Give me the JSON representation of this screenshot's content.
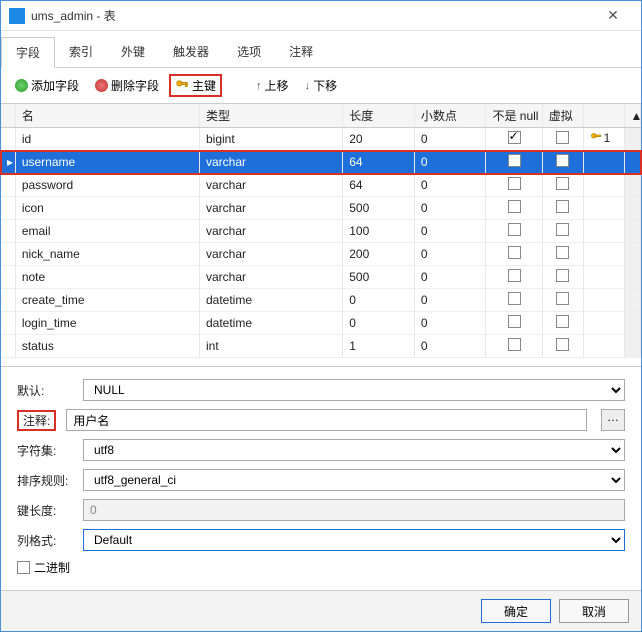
{
  "window": {
    "title": "ums_admin - 表"
  },
  "tabs": [
    "字段",
    "索引",
    "外键",
    "触发器",
    "选项",
    "注释"
  ],
  "toolbar": {
    "add_field": "添加字段",
    "del_field": "删除字段",
    "primary_key": "主键",
    "move_up": "上移",
    "move_down": "下移"
  },
  "columns": {
    "name": "名",
    "type": "类型",
    "length": "长度",
    "decimal": "小数点",
    "not_null": "不是 null",
    "virtual": "虚拟"
  },
  "fields": [
    {
      "name": "id",
      "type": "bigint",
      "length": "20",
      "decimal": "0",
      "not_null": true,
      "virtual": false,
      "pk": "1"
    },
    {
      "name": "username",
      "type": "varchar",
      "length": "64",
      "decimal": "0",
      "not_null": false,
      "virtual": false,
      "selected": true
    },
    {
      "name": "password",
      "type": "varchar",
      "length": "64",
      "decimal": "0",
      "not_null": false,
      "virtual": false
    },
    {
      "name": "icon",
      "type": "varchar",
      "length": "500",
      "decimal": "0",
      "not_null": false,
      "virtual": false
    },
    {
      "name": "email",
      "type": "varchar",
      "length": "100",
      "decimal": "0",
      "not_null": false,
      "virtual": false
    },
    {
      "name": "nick_name",
      "type": "varchar",
      "length": "200",
      "decimal": "0",
      "not_null": false,
      "virtual": false
    },
    {
      "name": "note",
      "type": "varchar",
      "length": "500",
      "decimal": "0",
      "not_null": false,
      "virtual": false
    },
    {
      "name": "create_time",
      "type": "datetime",
      "length": "0",
      "decimal": "0",
      "not_null": false,
      "virtual": false
    },
    {
      "name": "login_time",
      "type": "datetime",
      "length": "0",
      "decimal": "0",
      "not_null": false,
      "virtual": false
    },
    {
      "name": "status",
      "type": "int",
      "length": "1",
      "decimal": "0",
      "not_null": false,
      "virtual": false
    }
  ],
  "details": {
    "labels": {
      "default": "默认:",
      "comment": "注释:",
      "charset": "字符集:",
      "collation": "排序规则:",
      "key_length": "键长度:",
      "column_format": "列格式:",
      "binary": "二进制"
    },
    "default": "NULL",
    "comment": "用户名",
    "charset": "utf8",
    "collation": "utf8_general_ci",
    "key_length": "0",
    "column_format": "Default"
  },
  "footer": {
    "ok": "确定",
    "cancel": "取消"
  }
}
